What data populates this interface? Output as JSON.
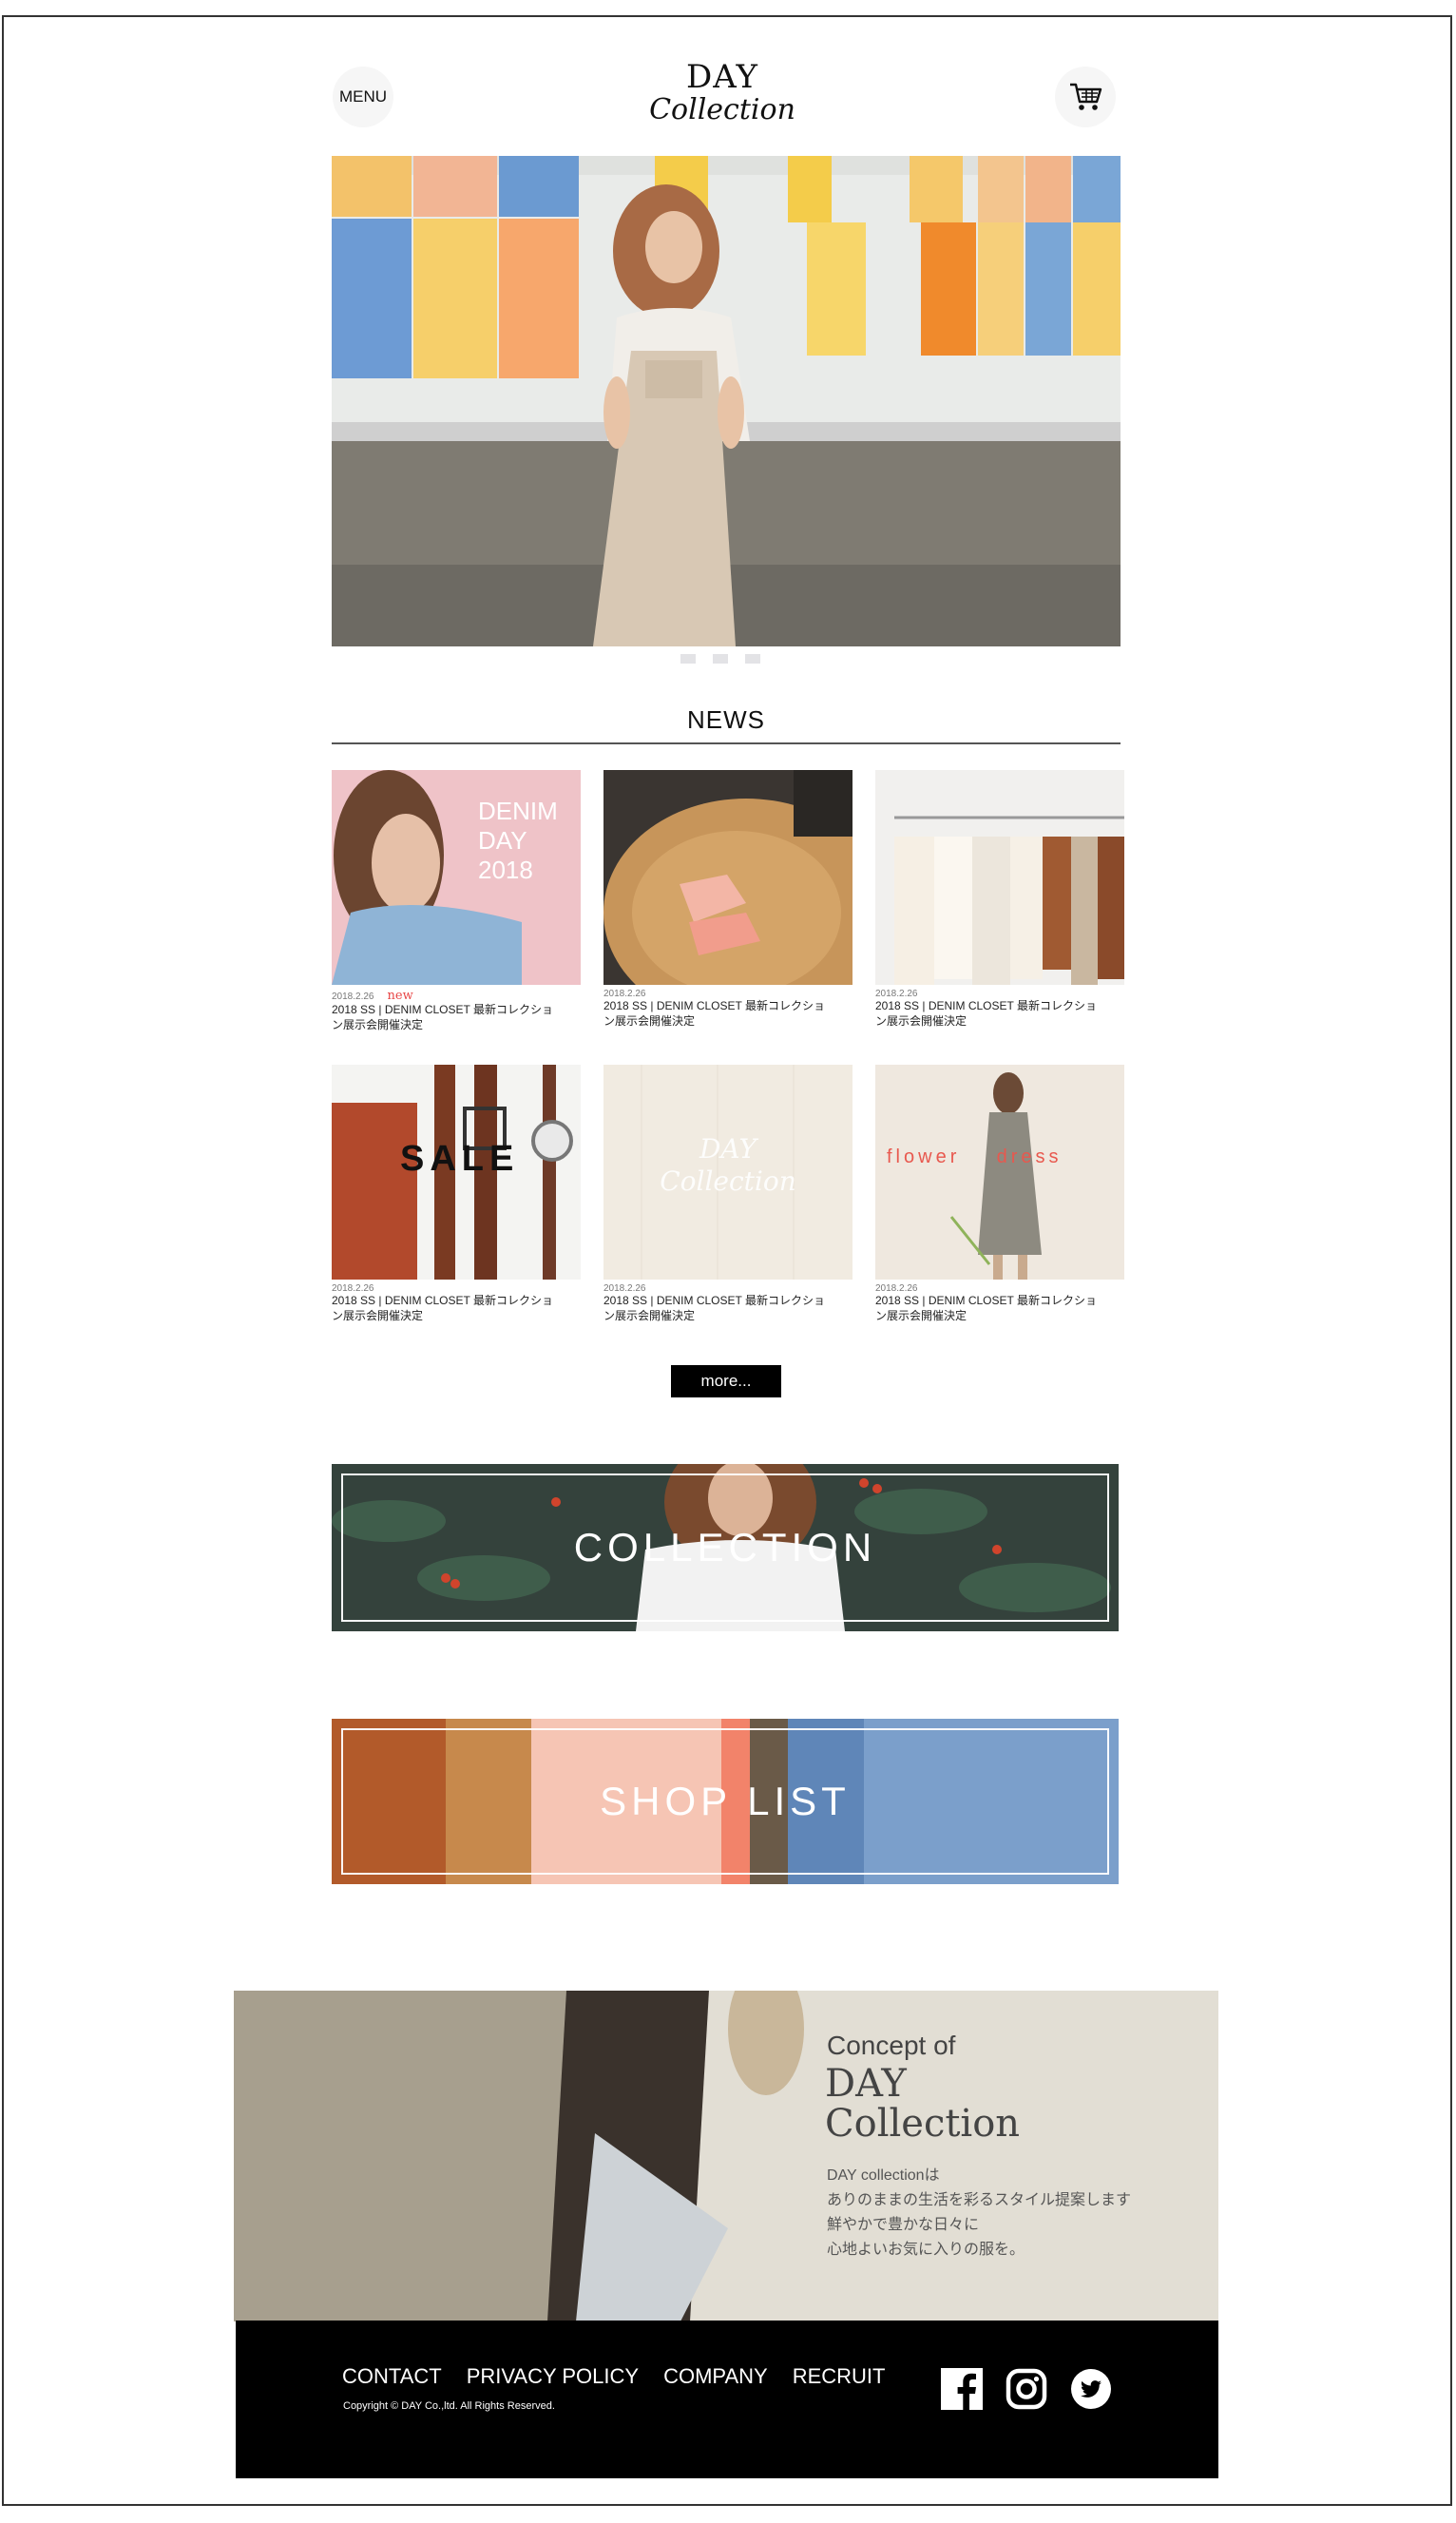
{
  "header": {
    "menu_label": "MENU",
    "logo_line1": "DAY",
    "logo_line2": "Collection"
  },
  "news": {
    "title": "NEWS",
    "items": [
      {
        "date": "2018.2.26",
        "badge": "new",
        "title": "2018 SS | DENIM CLOSET 最新コレクション展示会開催決定",
        "overlay": "DENIM\nDAY\n2018"
      },
      {
        "date": "2018.2.26",
        "badge": "",
        "title": "2018 SS | DENIM CLOSET 最新コレクション展示会開催決定",
        "overlay": ""
      },
      {
        "date": "2018.2.26",
        "badge": "",
        "title": "2018 SS | DENIM CLOSET 最新コレクション展示会開催決定",
        "overlay": ""
      },
      {
        "date": "2018.2.26",
        "badge": "",
        "title": "2018 SS | DENIM CLOSET 最新コレクション展示会開催決定",
        "overlay": "SALE"
      },
      {
        "date": "2018.2.26",
        "badge": "",
        "title": "2018 SS | DENIM CLOSET 最新コレクション展示会開催決定",
        "overlay": "DAY\nCollection"
      },
      {
        "date": "2018.2.26",
        "badge": "",
        "title": "2018 SS | DENIM CLOSET 最新コレクション展示会開催決定",
        "overlay": "flower    dress"
      }
    ],
    "more_label": "more..."
  },
  "banners": {
    "collection": "COLLECTION",
    "shoplist": "SHOP LIST"
  },
  "concept": {
    "of": "Concept of",
    "day": "DAY",
    "collection": "Collection",
    "lines": [
      "DAY collectionは",
      "ありのままの生活を彩るスタイル提案します",
      "鮮やかで豊かな日々に",
      "心地よいお気に入りの服を。"
    ]
  },
  "footer": {
    "links": [
      "CONTACT",
      "PRIVACY POLICY",
      "COMPANY",
      "RECRUIT"
    ],
    "copyright": "Copyright © DAY Co.,ltd. All Rights Reserved.",
    "social_icons": [
      "facebook-icon",
      "instagram-icon",
      "twitter-icon"
    ]
  }
}
